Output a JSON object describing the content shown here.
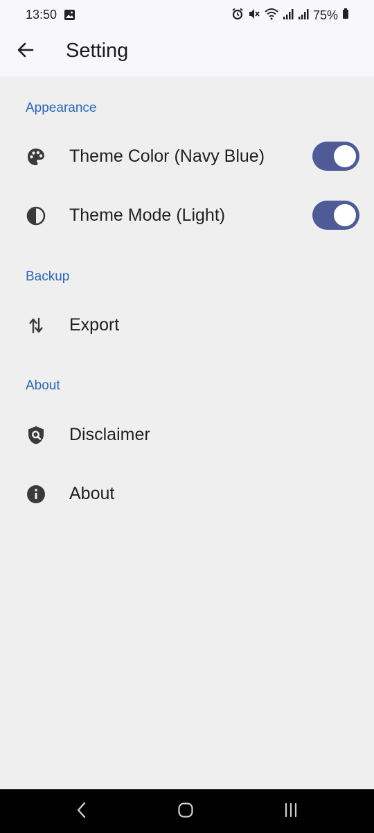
{
  "status_bar": {
    "time": "13:50",
    "battery": "75%",
    "icons": [
      "image-icon",
      "alarm-icon",
      "mute-icon",
      "wifi-icon",
      "signal-icon",
      "signal-r-icon",
      "battery-icon"
    ]
  },
  "app_bar": {
    "title": "Setting",
    "back_icon": "arrow-left-icon"
  },
  "sections": [
    {
      "header": "Appearance",
      "items": [
        {
          "label": "Theme Color (Navy Blue)",
          "icon": "palette-icon",
          "toggle_on": true
        },
        {
          "label": "Theme Mode (Light)",
          "icon": "contrast-icon",
          "toggle_on": true
        }
      ]
    },
    {
      "header": "Backup",
      "items": [
        {
          "label": "Export",
          "icon": "swap-vertical-icon"
        }
      ]
    },
    {
      "header": "About",
      "items": [
        {
          "label": "Disclaimer",
          "icon": "shield-search-icon"
        },
        {
          "label": "About",
          "icon": "info-icon"
        }
      ]
    }
  ],
  "colors": {
    "section_header": "#2a64b8",
    "toggle_track": "#4e5b96",
    "background": "#efefef",
    "app_bar": "#f8f8fc"
  },
  "nav_bar": {
    "icons": [
      "nav-back-icon",
      "nav-home-icon",
      "nav-recents-icon"
    ]
  }
}
